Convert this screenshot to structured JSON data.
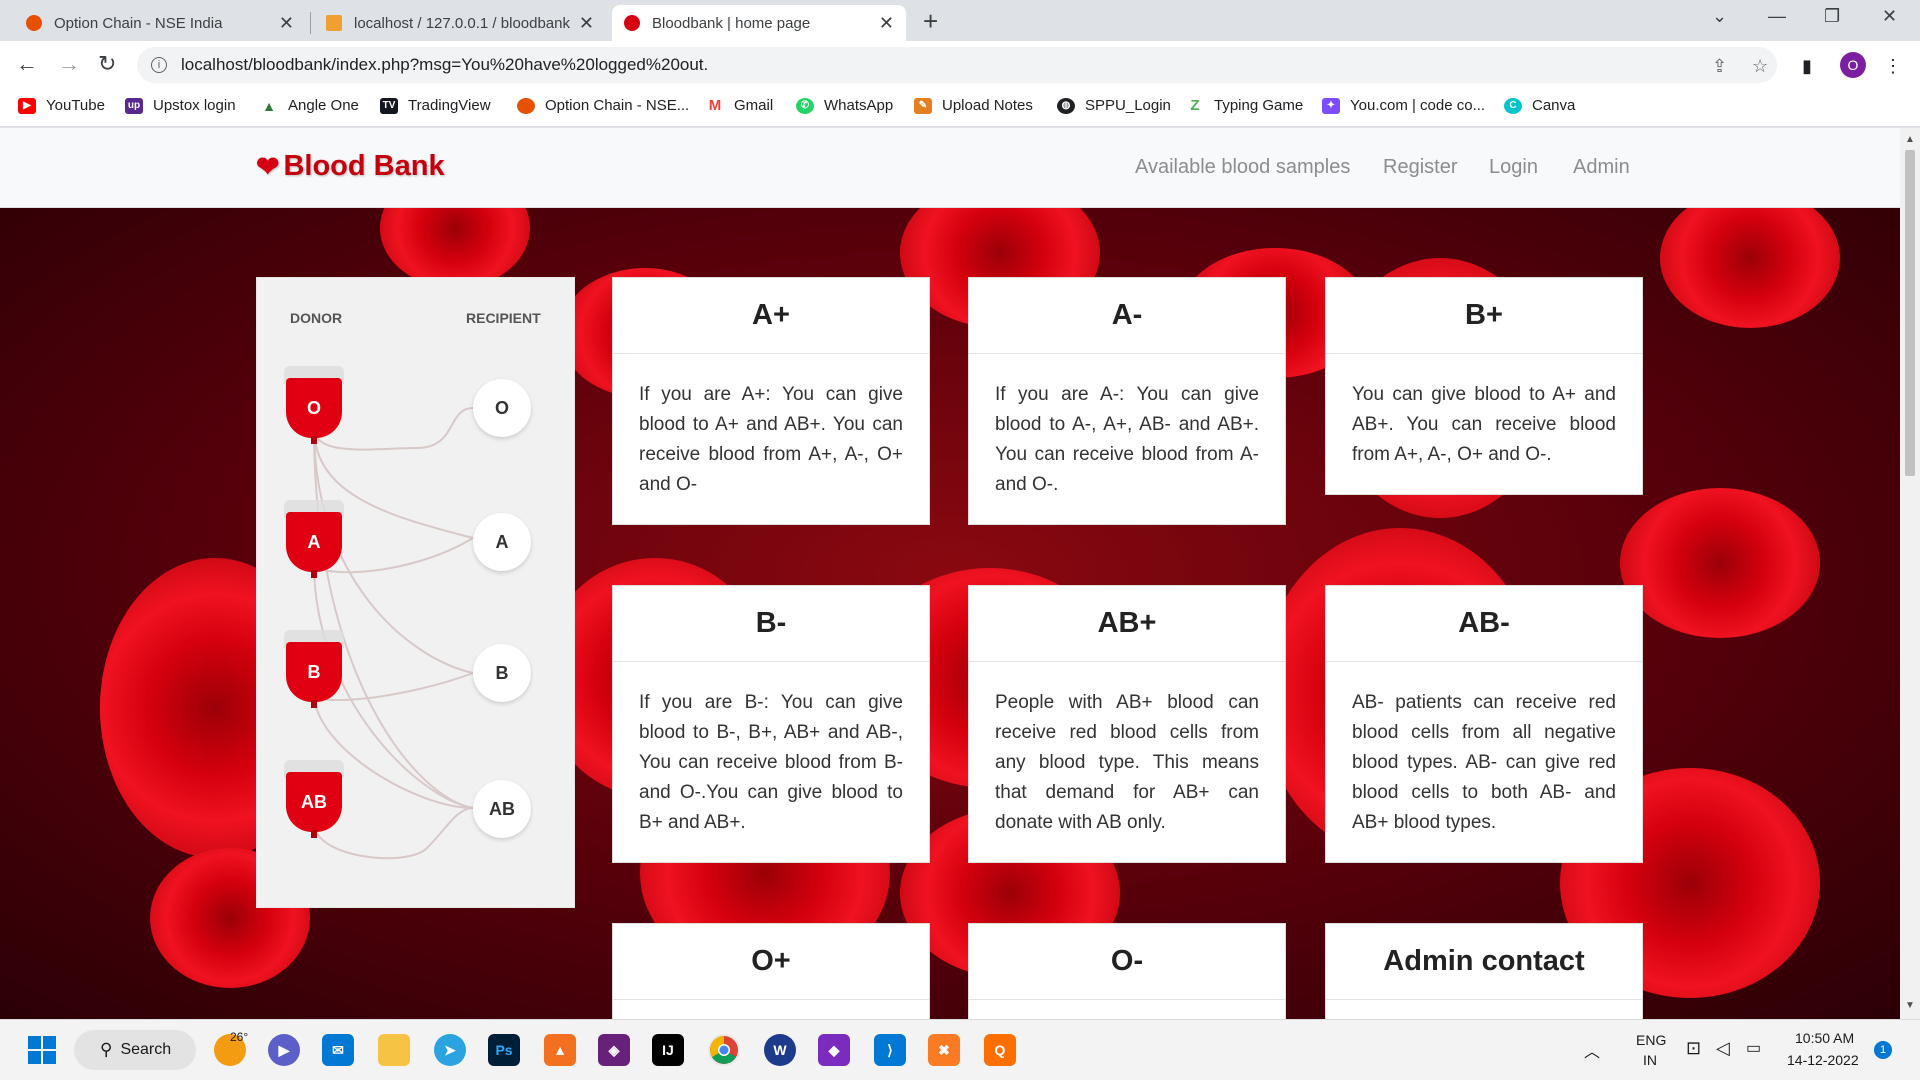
{
  "browser": {
    "tabs": [
      {
        "title": "Option Chain - NSE India",
        "icon": "nse-icon",
        "active": false
      },
      {
        "title": "localhost / 127.0.0.1 / bloodbank",
        "icon": "phpmyadmin-icon",
        "active": false
      },
      {
        "title": "Bloodbank | home page",
        "icon": "blood-icon",
        "active": true
      }
    ],
    "url": "localhost/bloodbank/index.php?msg=You%20have%20logged%20out.",
    "profile_initial": "O",
    "bookmarks": [
      {
        "label": "YouTube",
        "icon": "youtube-icon",
        "color": "#ff0000"
      },
      {
        "label": "Upstox login",
        "icon": "upstox-icon",
        "color": "#5a298b"
      },
      {
        "label": "Angle One",
        "icon": "angelone-icon",
        "color": "#2e7d32"
      },
      {
        "label": "TradingView",
        "icon": "tradingview-icon",
        "color": "#131722"
      },
      {
        "label": "Option Chain - NSE...",
        "icon": "nse-icon",
        "color": "#e65100"
      },
      {
        "label": "Gmail",
        "icon": "gmail-icon",
        "color": "#ea4335"
      },
      {
        "label": "WhatsApp",
        "icon": "whatsapp-icon",
        "color": "#25d366"
      },
      {
        "label": "Upload Notes",
        "icon": "notes-icon",
        "color": "#e67e22"
      },
      {
        "label": "SPPU_Login",
        "icon": "globe-icon",
        "color": "#202124"
      },
      {
        "label": "Typing Game",
        "icon": "typing-icon",
        "color": "#4caf50"
      },
      {
        "label": "You.com | code co...",
        "icon": "youcom-icon",
        "color": "#7c4dff"
      },
      {
        "label": "Canva",
        "icon": "canva-icon",
        "color": "#00c4cc"
      }
    ]
  },
  "site": {
    "brand": "Blood Bank",
    "nav": [
      "Available blood samples",
      "Register",
      "Login",
      "Admin"
    ],
    "chart": {
      "donor_label": "DONOR",
      "recipient_label": "RECIPIENT",
      "donors": [
        "O",
        "A",
        "B",
        "AB"
      ],
      "recipients": [
        "O",
        "A",
        "B",
        "AB"
      ]
    },
    "cards": [
      {
        "title": "A+",
        "text": "If you are A+: You can give blood to A+ and AB+. You can receive blood from A+, A-, O+ and O-"
      },
      {
        "title": "A-",
        "text": "If you are A-: You can give blood to A-, A+, AB- and AB+. You can receive blood from A- and O-."
      },
      {
        "title": "B+",
        "text": "You can give blood to A+ and AB+. You can receive blood from A+, A-, O+ and O-."
      },
      {
        "title": "B-",
        "text": "If you are B-: You can give blood to B-, B+, AB+ and AB-, You can receive blood from B- and O-.You can give blood to B+ and AB+."
      },
      {
        "title": "AB+",
        "text": "People with AB+ blood can receive red blood cells from any blood type. This means that demand for AB+ can donate with AB only."
      },
      {
        "title": "AB-",
        "text": "AB- patients can receive red blood cells from all negative blood types. AB- can give red blood cells to both AB- and AB+ blood types."
      },
      {
        "title": "O+",
        "text": ""
      },
      {
        "title": "O-",
        "text": ""
      },
      {
        "title": "Admin contact",
        "text": ""
      }
    ]
  },
  "taskbar": {
    "search_label": "Search",
    "weather": "26°",
    "lang_line1": "ENG",
    "lang_line2": "IN",
    "time": "10:50 AM",
    "date": "14-12-2022",
    "notifications": "1"
  }
}
